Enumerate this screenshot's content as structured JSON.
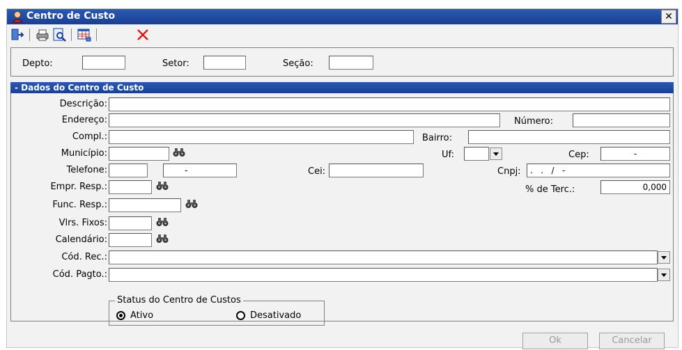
{
  "window": {
    "title": "Centro de Custo"
  },
  "toolbar": {
    "icons": [
      "exit-icon",
      "printer-icon",
      "preview-icon",
      "grid-icon",
      "delete-icon"
    ]
  },
  "filter": {
    "depto_label": "Depto:",
    "setor_label": "Setor:",
    "secao_label": "Seção:"
  },
  "section": {
    "title": "- Dados do Centro de Custo"
  },
  "form": {
    "descricao_label": "Descrição:",
    "endereco_label": "Endereço:",
    "numero_label": "Número:",
    "compl_label": "Compl.:",
    "bairro_label": "Bairro:",
    "municipio_label": "Município:",
    "uf_label": "Uf:",
    "cep_label": "Cep:",
    "cep_value": "-",
    "telefone_label": "Telefone:",
    "telefone_value": "-",
    "cei_label": "Cei:",
    "cnpj_label": "Cnpj:",
    "cnpj_value": ".   .   /   -",
    "empr_resp_label": "Empr. Resp.:",
    "terc_label": "% de Terc.:",
    "terc_value": "0,000",
    "func_resp_label": "Func. Resp.:",
    "vlrs_fixos_label": "Vlrs. Fixos:",
    "calendario_label": "Calendário:",
    "cod_rec_label": "Cód. Rec.:",
    "cod_pagto_label": "Cód. Pagto.:"
  },
  "status": {
    "legend": "Status do Centro de Custos",
    "ativo_label": "Ativo",
    "desativado_label": "Desativado",
    "selected": "Ativo"
  },
  "buttons": {
    "ok": "Ok",
    "cancelar": "Cancelar"
  }
}
